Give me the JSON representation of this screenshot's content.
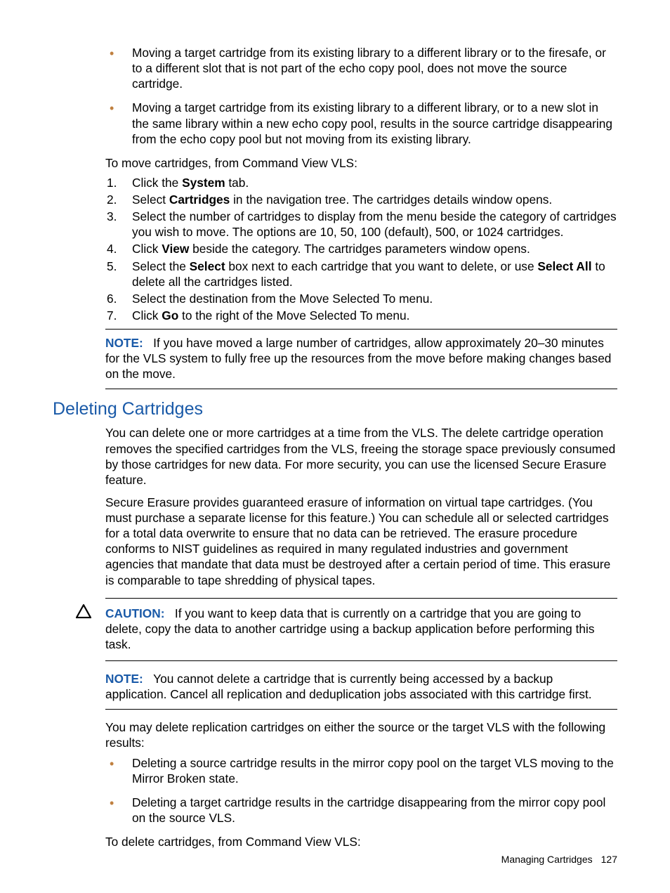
{
  "top_bullets": [
    "Moving a target cartridge from its existing library to a different library or to the firesafe, or to a different slot that is not part of the echo copy pool, does not move the source cartridge.",
    "Moving a target cartridge from its existing library to a different library, or to a new slot in the same library within a new echo copy pool, results in the source cartridge disappearing from the echo copy pool but not moving from its existing library."
  ],
  "move_intro": "To move cartridges, from Command View VLS:",
  "steps": {
    "s1a": "Click the ",
    "s1b": "System",
    "s1c": " tab.",
    "s2a": "Select ",
    "s2b": "Cartridges",
    "s2c": " in the navigation tree. The cartridges details window opens.",
    "s3": "Select the number of cartridges to display from the menu beside the category of cartridges you wish to move. The options are 10, 50, 100 (default), 500, or 1024 cartridges.",
    "s4a": "Click ",
    "s4b": "View",
    "s4c": " beside the category. The cartridges parameters window opens.",
    "s5a": "Select the ",
    "s5b": "Select",
    "s5c": " box next to each cartridge that you want to delete, or use ",
    "s5d": "Select All",
    "s5e": " to delete all the cartridges listed.",
    "s6": "Select the destination from the Move Selected To menu.",
    "s7a": "Click ",
    "s7b": "Go",
    "s7c": " to the right of the Move Selected To menu."
  },
  "note1": {
    "label": "NOTE:",
    "text": "If you have moved a large number of cartridges, allow approximately 20–30 minutes for the VLS system to fully free up the resources from the move before making changes based on the move."
  },
  "heading": "Deleting Cartridges",
  "del_para1": "You can delete one or more cartridges at a time from the VLS. The delete cartridge operation removes the specified cartridges from the VLS, freeing the storage space previously consumed by those cartridges for new data. For more security, you can use the licensed Secure Erasure feature.",
  "del_para2": "Secure Erasure provides guaranteed erasure of information on virtual tape cartridges. (You must purchase a separate license for this feature.) You can schedule all or selected cartridges for a total data overwrite to ensure that no data can be retrieved. The erasure procedure conforms to NIST guidelines as required in many regulated industries and government agencies that mandate that data must be destroyed after a certain period of time. This erasure is comparable to tape shredding of physical tapes.",
  "caution": {
    "label": "CAUTION:",
    "text": "If you want to keep data that is currently on a cartridge that you are going to delete, copy the data to another cartridge using a backup application before performing this task."
  },
  "note2": {
    "label": "NOTE:",
    "text": "You cannot delete a cartridge that is currently being accessed by a backup application. Cancel all replication and deduplication jobs associated with this cartridge first."
  },
  "del_results_intro": "You may delete replication cartridges on either the source or the target VLS with the following results:",
  "del_bullets": [
    "Deleting a source cartridge results in the mirror copy pool on the target VLS moving to the Mirror Broken state.",
    "Deleting a target cartridge results in the cartridge disappearing from the mirror copy pool on the source VLS."
  ],
  "del_intro": "To delete cartridges, from Command View VLS:",
  "footer": {
    "section": "Managing Cartridges",
    "page": "127"
  }
}
